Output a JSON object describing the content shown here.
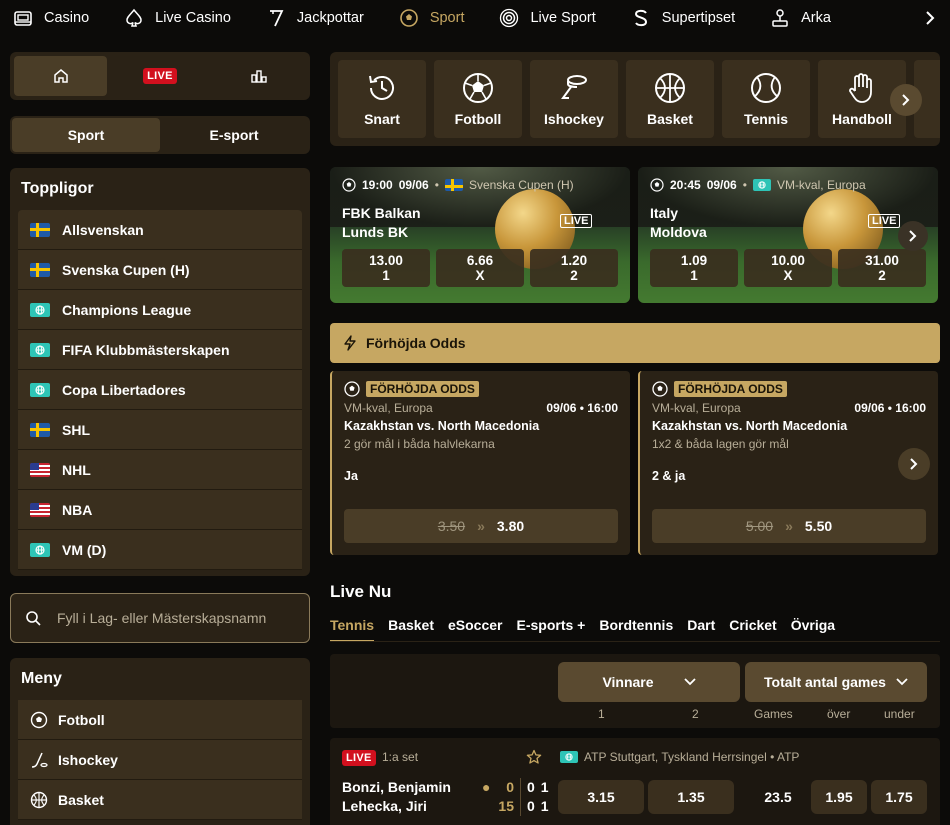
{
  "topnav": {
    "items": [
      {
        "label": "Casino",
        "icon": "casino-icon"
      },
      {
        "label": "Live Casino",
        "icon": "spade-icon"
      },
      {
        "label": "Jackpottar",
        "icon": "seven-icon"
      },
      {
        "label": "Sport",
        "icon": "football-icon",
        "active": true
      },
      {
        "label": "Live Sport",
        "icon": "live-signal-icon"
      },
      {
        "label": "Supertipset",
        "icon": "supertipset-icon"
      },
      {
        "label": "Arka",
        "icon": "arcade-joystick-icon"
      }
    ]
  },
  "quickbar": {
    "live_label": "LIVE"
  },
  "sport_toggle": {
    "sport": "Sport",
    "esport": "E-sport"
  },
  "toppligor": {
    "title": "Toppligor",
    "items": [
      {
        "label": "Allsvenskan",
        "flag": "se"
      },
      {
        "label": "Svenska Cupen (H)",
        "flag": "se"
      },
      {
        "label": "Champions League",
        "flag": "globe"
      },
      {
        "label": "FIFA Klubbmästerskapen",
        "flag": "globe"
      },
      {
        "label": "Copa Libertadores",
        "flag": "globe"
      },
      {
        "label": "SHL",
        "flag": "se"
      },
      {
        "label": "NHL",
        "flag": "us"
      },
      {
        "label": "NBA",
        "flag": "us"
      },
      {
        "label": "VM (D)",
        "flag": "globe"
      }
    ]
  },
  "search": {
    "placeholder": "Fyll i Lag- eller Mästerskapsnamn"
  },
  "meny": {
    "title": "Meny",
    "items": [
      {
        "label": "Fotboll"
      },
      {
        "label": "Ishockey"
      },
      {
        "label": "Basket"
      }
    ]
  },
  "sport_tiles": [
    {
      "label": "Snart",
      "icon": "clock-history-icon"
    },
    {
      "label": "Fotboll",
      "icon": "football-icon"
    },
    {
      "label": "Ishockey",
      "icon": "hockey-stick-icon"
    },
    {
      "label": "Basket",
      "icon": "basketball-icon"
    },
    {
      "label": "Tennis",
      "icon": "tennis-ball-icon"
    },
    {
      "label": "Handboll",
      "icon": "hand-icon"
    }
  ],
  "match_cards": [
    {
      "time": "19:00",
      "date": "09/06",
      "league": "Svenska Cupen (H)",
      "flag": "se",
      "home": "FBK Balkan",
      "away": "Lunds BK",
      "live": "LIVE",
      "odds": [
        {
          "value": "13.00",
          "label": "1"
        },
        {
          "value": "6.66",
          "label": "X"
        },
        {
          "value": "1.20",
          "label": "2"
        }
      ]
    },
    {
      "time": "20:45",
      "date": "09/06",
      "league": "VM-kval, Europa",
      "flag": "globe",
      "home": "Italy",
      "away": "Moldova",
      "live": "LIVE",
      "odds": [
        {
          "value": "1.09",
          "label": "1"
        },
        {
          "value": "10.00",
          "label": "X"
        },
        {
          "value": "31.00",
          "label": "2"
        }
      ]
    }
  ],
  "boost": {
    "header": "Förhöjda Odds",
    "cards": [
      {
        "tag": "FÖRHÖJDA ODDS",
        "league": "VM-kval, Europa",
        "datetime": "09/06 • 16:00",
        "match": "Kazakhstan vs. North Macedonia",
        "desc": "2 gör mål i båda halvlekarna",
        "pick": "Ja",
        "old_odd": "3.50",
        "new_odd": "3.80"
      },
      {
        "tag": "FÖRHÖJDA ODDS",
        "league": "VM-kval, Europa",
        "datetime": "09/06 • 16:00",
        "match": "Kazakhstan vs. North Macedonia",
        "desc": "1x2 & båda lagen gör mål",
        "pick": "2 & ja",
        "old_odd": "5.00",
        "new_odd": "5.50"
      }
    ]
  },
  "live_now": {
    "title": "Live Nu",
    "tabs": [
      "Tennis",
      "Basket",
      "eSoccer",
      "E-sports +",
      "Bordtennis",
      "Dart",
      "Cricket",
      "Övriga"
    ],
    "markets": {
      "winner": "Vinnare",
      "total": "Totalt antal games"
    },
    "columns": {
      "c1": "1",
      "c2": "2",
      "games": "Games",
      "over": "över",
      "under": "under"
    },
    "match": {
      "live": "LIVE",
      "set": "1:a set",
      "tournament": "ATP Stuttgart, Tyskland Herrsingel • ATP",
      "player1": "Bonzi, Benjamin",
      "player2": "Lehecka, Jiri",
      "p1_points": "0",
      "p2_points": "15",
      "p1_g1": "0",
      "p1_g2": "1",
      "p2_g1": "0",
      "p2_g2": "1",
      "odd1": "3.15",
      "odd2": "1.35",
      "games_line": "23.5",
      "over": "1.95",
      "under": "1.75"
    }
  }
}
